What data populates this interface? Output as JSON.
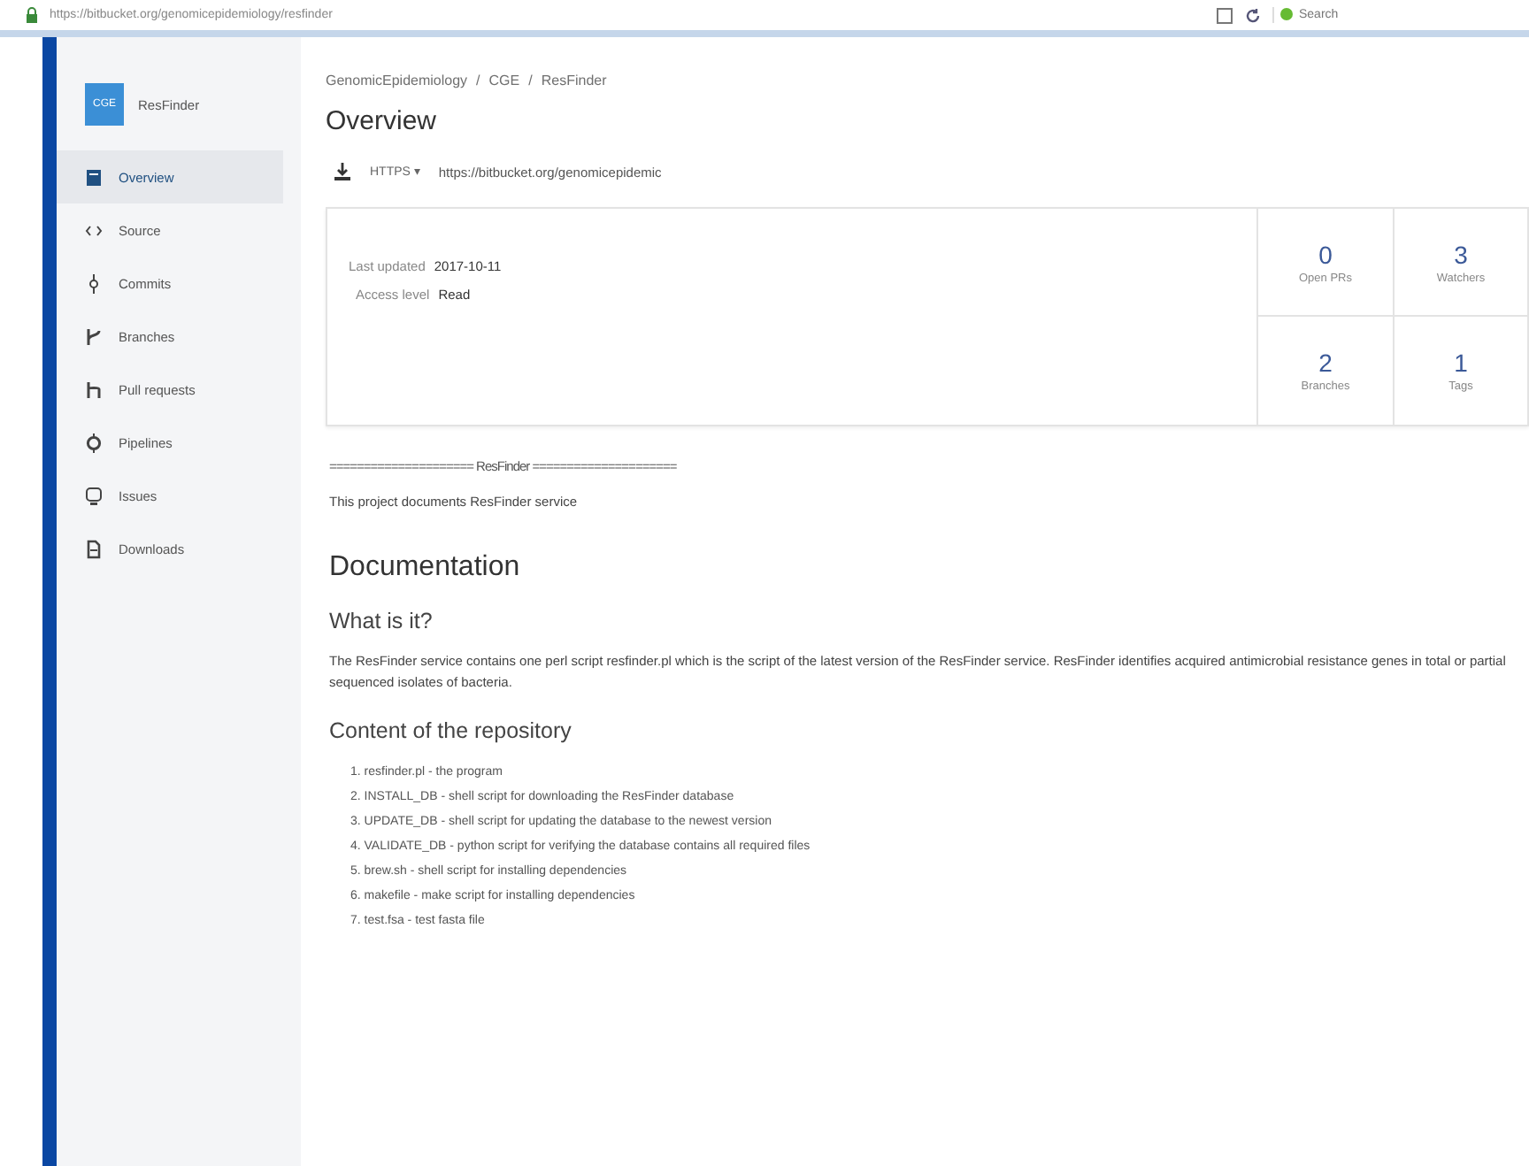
{
  "browser": {
    "url": "https://bitbucket.org/genomicepidemiology/resfinder",
    "search_placeholder": "Search"
  },
  "sidebar": {
    "avatar": "CGE",
    "project": "ResFinder",
    "items": [
      {
        "label": "Overview",
        "kind": "overview",
        "selected": true
      },
      {
        "label": "Source",
        "kind": "source",
        "selected": false
      },
      {
        "label": "Commits",
        "kind": "commits",
        "selected": false
      },
      {
        "label": "Branches",
        "kind": "branches",
        "selected": false
      },
      {
        "label": "Pull requests",
        "kind": "pull",
        "selected": false
      },
      {
        "label": "Pipelines",
        "kind": "pipelines",
        "selected": false
      },
      {
        "label": "Issues",
        "kind": "issues",
        "selected": false
      },
      {
        "label": "Downloads",
        "kind": "downloads",
        "selected": false
      }
    ]
  },
  "breadcrumb": [
    "GenomicEpidemiology",
    "/",
    "CGE",
    "/",
    "ResFinder"
  ],
  "title": "Overview",
  "clone": {
    "protocol": "HTTPS",
    "caret": "▾",
    "url": "https://bitbucket.org/genomicepidemic"
  },
  "info": [
    {
      "label": "Last updated",
      "value": "2017-10-11"
    },
    {
      "label": "Access level",
      "value": "Read"
    }
  ],
  "stats": [
    {
      "value": "0",
      "label": "Open PRs"
    },
    {
      "value": "3",
      "label": "Watchers"
    },
    {
      "value": "2",
      "label": "Branches"
    },
    {
      "value": "1",
      "label": "Tags"
    }
  ],
  "readme": {
    "banner": "===================== ResFinder =====================",
    "intro": "This project documents ResFinder service",
    "heading": "Documentation",
    "subheading": "What is it?",
    "paragraph": "The ResFinder service contains one perl script resfinder.pl which is the script of the latest version of the ResFinder service. ResFinder identifies acquired antimicrobial resistance genes in total or partial sequenced isolates of bacteria.",
    "contents_heading": "Content of the repository",
    "contents": [
      "1. resfinder.pl - the program",
      "2. INSTALL_DB - shell script for downloading the ResFinder database",
      "3. UPDATE_DB - shell script for updating the database to the newest version",
      "4. VALIDATE_DB - python script for verifying the database contains all required files",
      "5. brew.sh - shell script for installing dependencies",
      "6. makefile - make script for installing dependencies",
      "7. test.fsa - test fasta file"
    ]
  }
}
